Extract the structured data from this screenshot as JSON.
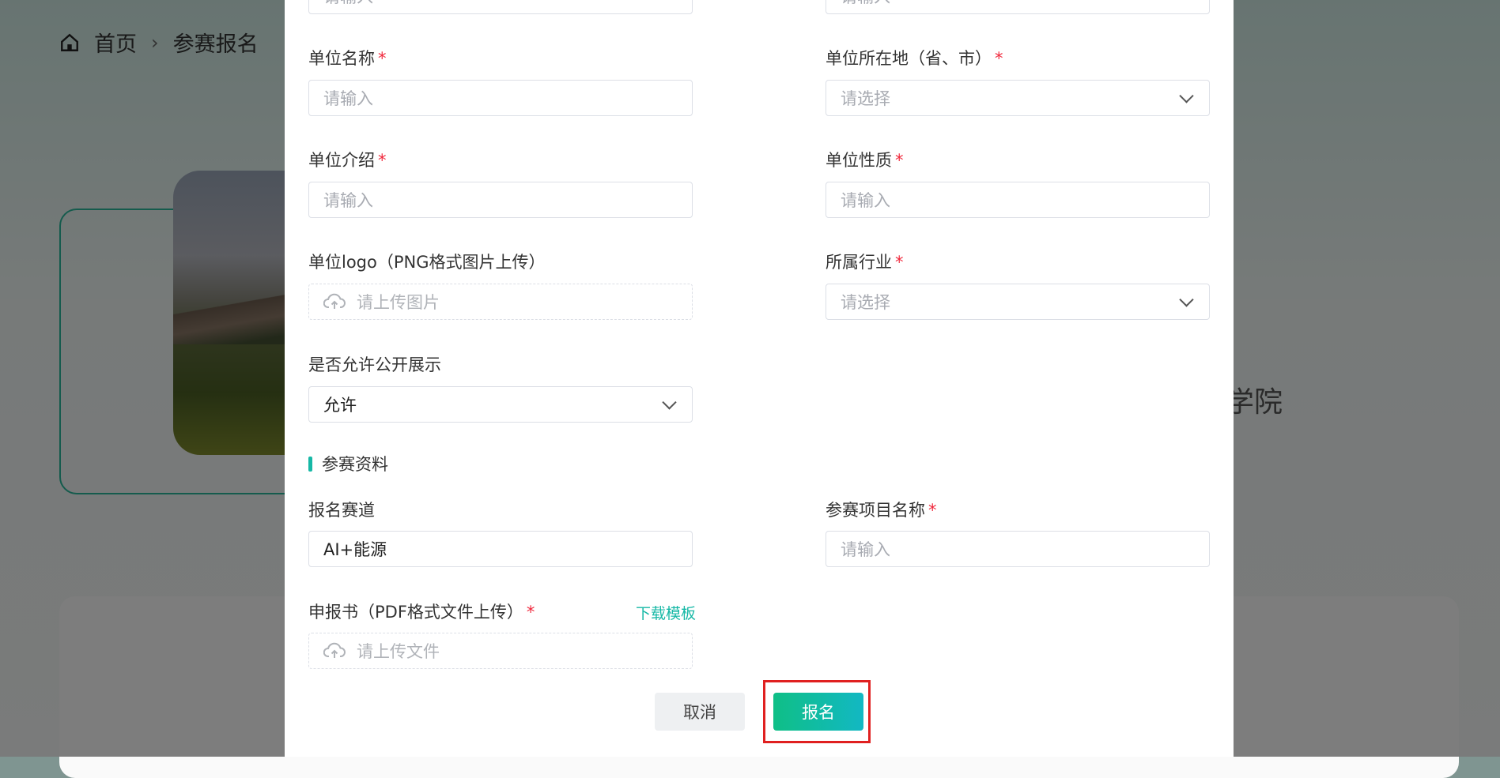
{
  "breadcrumb": {
    "home": "首页",
    "separator": "›",
    "current": "参赛报名"
  },
  "background": {
    "side_text": "学院"
  },
  "form": {
    "top_left_placeholder": "请输入",
    "top_right_placeholder": "请输入",
    "unit_name": {
      "label": "单位名称",
      "placeholder": "请输入"
    },
    "unit_location": {
      "label": "单位所在地（省、市）",
      "placeholder": "请选择"
    },
    "unit_intro": {
      "label": "单位介绍",
      "placeholder": "请输入"
    },
    "unit_nature": {
      "label": "单位性质",
      "placeholder": "请输入"
    },
    "unit_logo": {
      "label": "单位logo（PNG格式图片上传）",
      "placeholder": "请上传图片"
    },
    "industry": {
      "label": "所属行业",
      "placeholder": "请选择"
    },
    "public_display": {
      "label": "是否允许公开展示",
      "value": "允许"
    },
    "section_title": "参赛资料",
    "track": {
      "label": "报名赛道",
      "value": "AI+能源"
    },
    "project_name": {
      "label": "参赛项目名称",
      "placeholder": "请输入"
    },
    "application": {
      "label": "申报书（PDF格式文件上传）",
      "placeholder": "请上传文件",
      "download_link": "下载模板"
    },
    "required_mark": "*",
    "cancel_label": "取消",
    "submit_label": "报名"
  },
  "colors": {
    "accent": "#16b8a6",
    "required": "#f0283c",
    "highlight": "#e02020"
  }
}
